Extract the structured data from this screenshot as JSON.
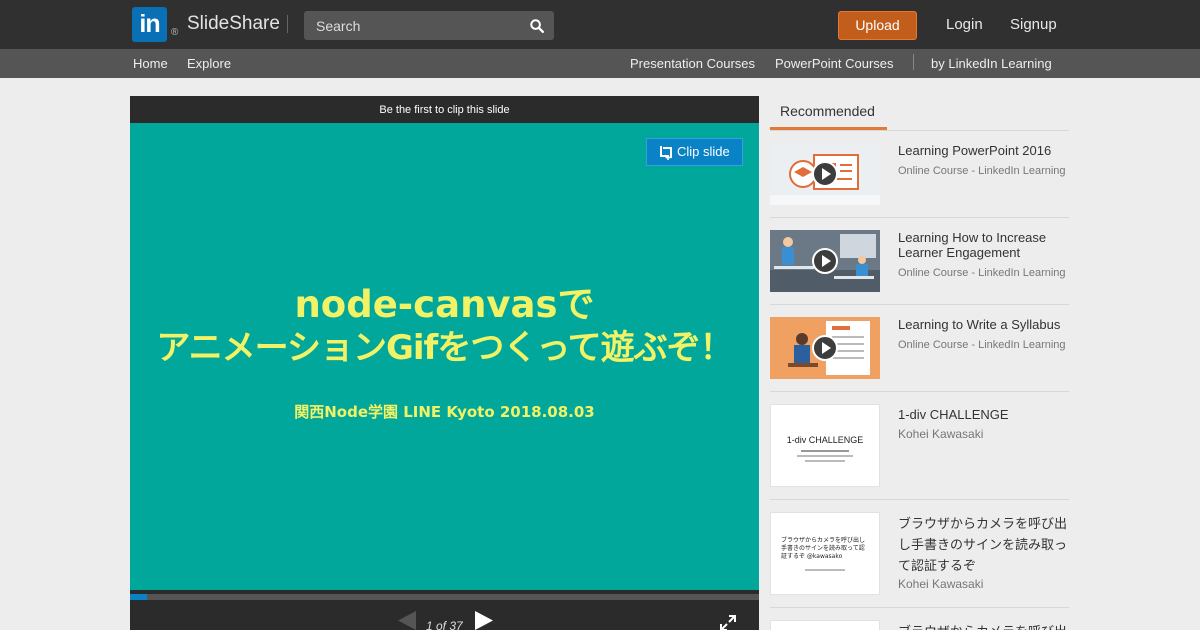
{
  "header": {
    "logo_text": "in",
    "logo_reg": "®",
    "brand": "SlideShare",
    "search_placeholder": "Search",
    "upload_label": "Upload",
    "login_label": "Login",
    "signup_label": "Signup"
  },
  "subnav": {
    "home": "Home",
    "explore": "Explore",
    "presentation_courses": "Presentation Courses",
    "powerpoint_courses": "PowerPoint Courses",
    "linkedin_learning": "by LinkedIn Learning"
  },
  "player": {
    "clip_banner": "Be the first to clip this slide",
    "clip_button": "Clip slide",
    "slide_title_line1": "node-canvasで",
    "slide_title_line2": "アニメーションGifをつくって遊ぶぞ！",
    "slide_subtitle": "関西Node学園 LINE Kyoto 2018.08.03",
    "page_counter": "1 of 37",
    "current_page": 1,
    "total_pages": 37
  },
  "sidebar": {
    "tab_label": "Recommended",
    "items": [
      {
        "title": "Learning PowerPoint 2016",
        "meta": "Online Course - LinkedIn Learning",
        "kind": "course"
      },
      {
        "title": "Learning How to Increase Learner Engagement",
        "meta": "Online Course - LinkedIn Learning",
        "kind": "course"
      },
      {
        "title": "Learning to Write a Syllabus",
        "meta": "Online Course - LinkedIn Learning",
        "kind": "course"
      },
      {
        "title": "1-div CHALLENGE",
        "author": "Kohei Kawasaki",
        "thumb_text": "1-div CHALLENGE",
        "kind": "slide"
      },
      {
        "title": "ブラウザからカメラを呼び出し手書きのサインを読み取って認証するぞ",
        "author": "Kohei Kawasaki",
        "thumb_text": "ブラウザからカメラを呼び出し手書きのサインを読み取って認証するぞ @kawasako",
        "kind": "slide"
      },
      {
        "title": "ブラウザからカメラを呼び出",
        "kind": "slide"
      }
    ]
  },
  "colors": {
    "header_bg": "#303030",
    "subnav_bg": "#555555",
    "upload_orange": "#c35d1b",
    "linkedin_blue": "#0a70b5",
    "slide_teal": "#00a79a",
    "slide_text_yellow": "#f2f266",
    "accent_orange": "#e07a35",
    "clip_blue": "#0a83c6"
  },
  "icons": {
    "search": "search-icon",
    "clip": "clip-icon",
    "prev": "prev-arrow-icon",
    "next": "next-arrow-icon",
    "fullscreen": "fullscreen-icon",
    "play": "play-icon"
  }
}
